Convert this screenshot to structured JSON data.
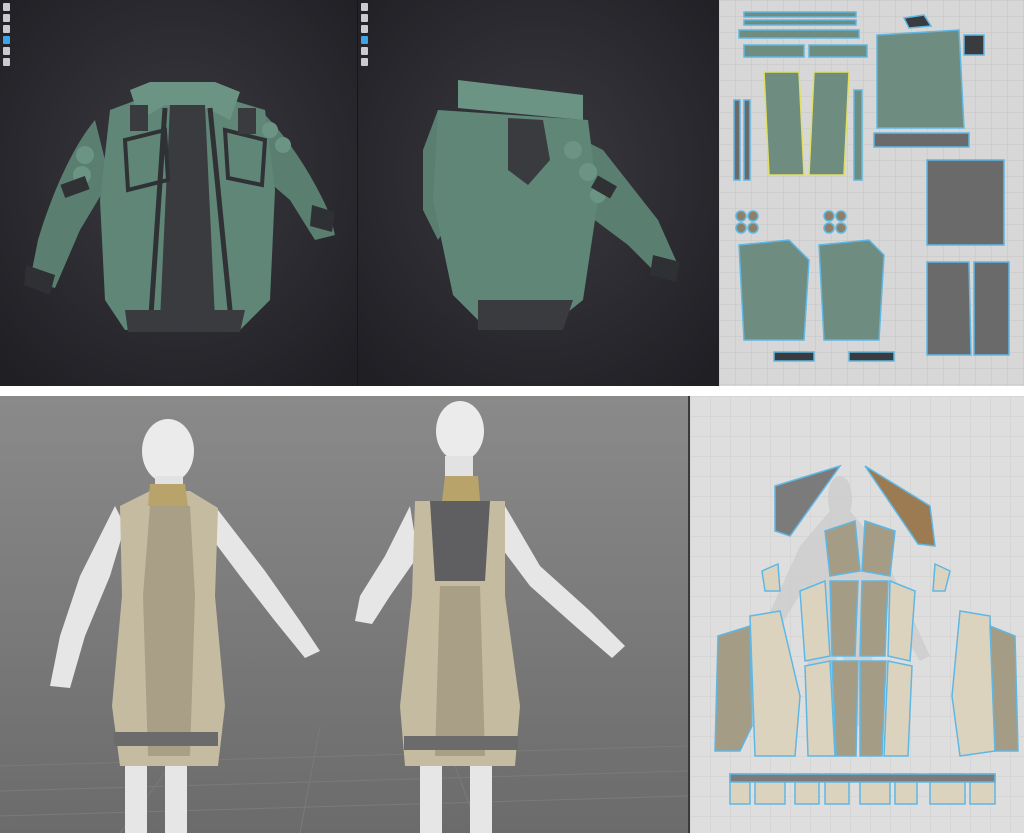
{
  "colors": {
    "viewport_dark": "#2b2b30",
    "jacket": "#5f8677",
    "jacket_light": "#7aa493",
    "jacket_trim": "#3a3b3e",
    "jacket_seam": "#a8554c",
    "uv_bg": "#d7d7d7",
    "uv_grid": "#c5c5c5",
    "uv_piece_gray": "#6a6a6a",
    "uv_piece_green": "#6e8c80",
    "uv_outline_blue": "#5fb7e3",
    "uv_outline_yellow": "#e0df63",
    "viewport_gray": "#8e8e8e",
    "avatar": "#ebebeb",
    "dress": "#c4bba0",
    "dress_dark": "#9f9683",
    "dress_band": "#6a6b6a",
    "dress_top_back": "#5f5f62",
    "collar_gold": "#b8a36b",
    "pattern_beige": "#dcd3bf",
    "pattern_khaki": "#a59c85",
    "pattern_brown": "#9c7a52",
    "pattern_slate": "#7b7b7b",
    "divider": "#ffffff"
  },
  "panels": [
    {
      "name": "jacket-front-viewport",
      "tool_icons": [
        "select-icon",
        "move-icon",
        "person-icon",
        "pen-icon",
        "fold-icon",
        "pin-icon"
      ],
      "active_tool": "pen-icon"
    },
    {
      "name": "jacket-back-viewport",
      "tool_icons": [
        "select-icon",
        "move-icon",
        "person-icon",
        "pen-icon",
        "fold-icon",
        "pin-icon"
      ],
      "active_tool": "pen-icon"
    },
    {
      "name": "jacket-uv-layout"
    },
    {
      "name": "dress-3d-viewport"
    },
    {
      "name": "dress-2d-pattern"
    }
  ]
}
